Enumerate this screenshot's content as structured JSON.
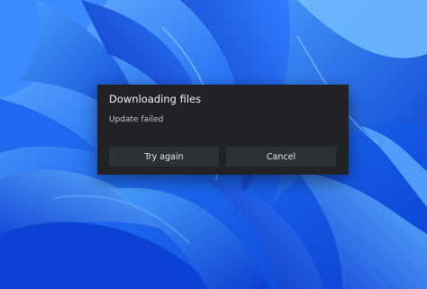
{
  "dialog": {
    "title": "Downloading files",
    "message": "Update failed",
    "primary_button_label": "Try again",
    "secondary_button_label": "Cancel"
  },
  "colors": {
    "dialog_background": "#202226",
    "button_background": "#2d3035",
    "wallpaper_primary": "#0a55e6"
  }
}
